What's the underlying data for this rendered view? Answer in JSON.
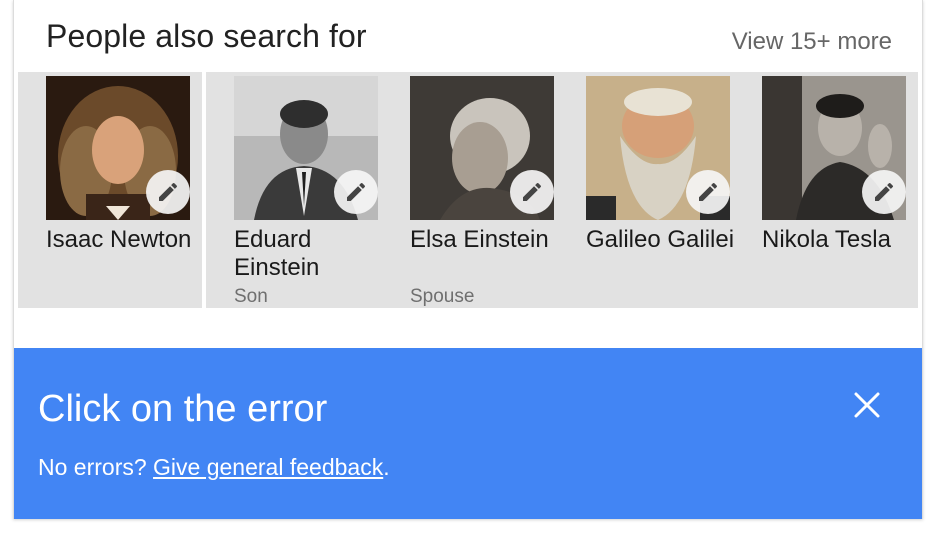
{
  "header": {
    "title": "People also search for",
    "view_more": "View 15+ more"
  },
  "people": [
    {
      "name": "Isaac Newton",
      "subtitle": ""
    },
    {
      "name": "Eduard Einstein",
      "subtitle": "Son"
    },
    {
      "name": "Elsa Einstein",
      "subtitle": "Spouse"
    },
    {
      "name": "Galileo Galilei",
      "subtitle": ""
    },
    {
      "name": "Nikola Tesla",
      "subtitle": ""
    }
  ],
  "feedback": {
    "title": "Click on the error",
    "prefix": "No errors? ",
    "link": "Give general feedback",
    "suffix": "."
  },
  "icons": {
    "edit": "pencil-icon",
    "close": "close-icon"
  },
  "colors": {
    "feedback_bg": "#4285f4",
    "tile_bg": "#e2e2e2"
  }
}
